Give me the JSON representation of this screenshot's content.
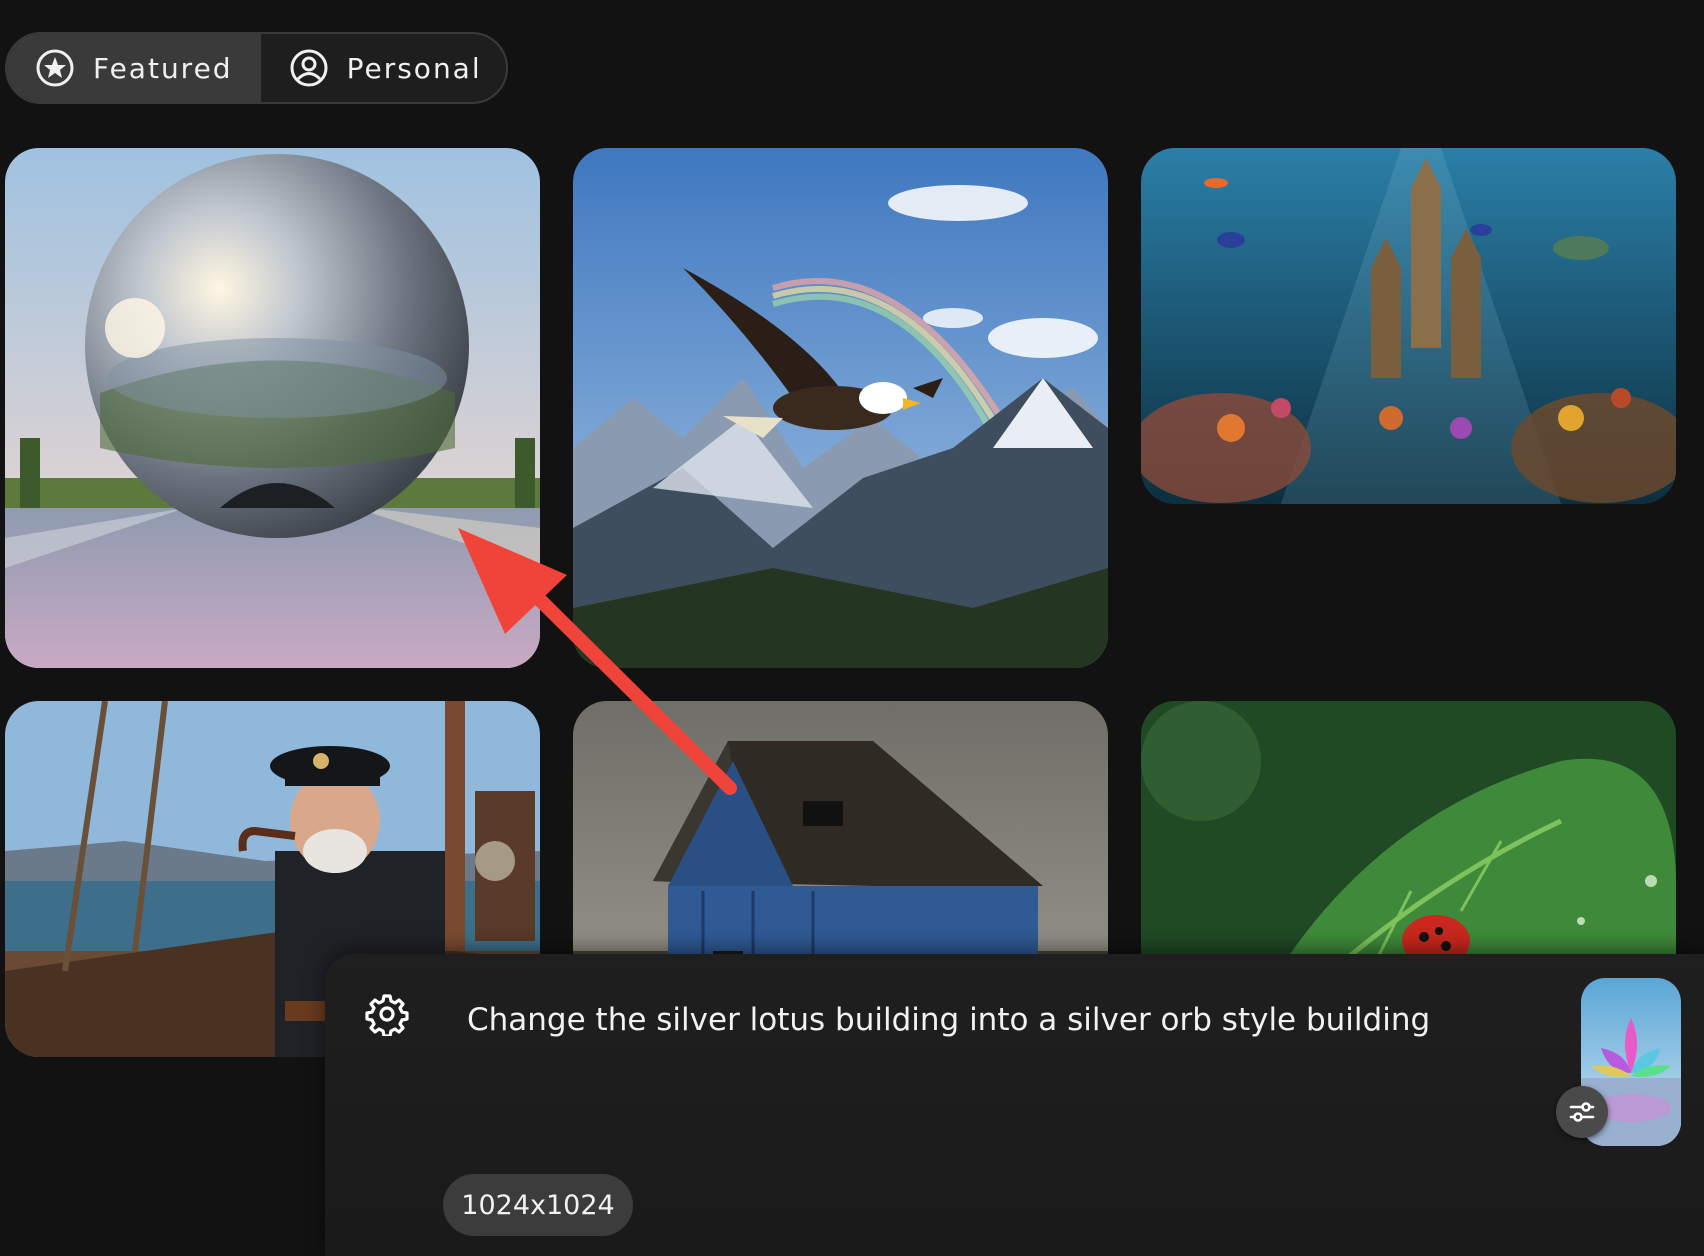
{
  "tabs": [
    {
      "label": "Featured",
      "icon": "star-circle-icon",
      "active": true
    },
    {
      "label": "Personal",
      "icon": "user-circle-icon",
      "active": false
    }
  ],
  "gallery": [
    {
      "subject": "silver orb building"
    },
    {
      "subject": "eagle over mountains"
    },
    {
      "subject": "underwater coral castle"
    },
    {
      "subject": "sea captain with pipe"
    },
    {
      "subject": "old blue barn"
    },
    {
      "subject": "ladybug on leaf"
    }
  ],
  "prompt_panel": {
    "prompt_text": "Change the silver lotus building into a silver orb style building",
    "size_label": "1024x1024",
    "settings_icon": "gear-icon",
    "adjust_icon": "sliders-icon"
  },
  "colors": {
    "background": "#121212",
    "panel": "#1f1f1f",
    "chip": "#3c3c3c",
    "annotation_arrow": "#f0443a"
  }
}
